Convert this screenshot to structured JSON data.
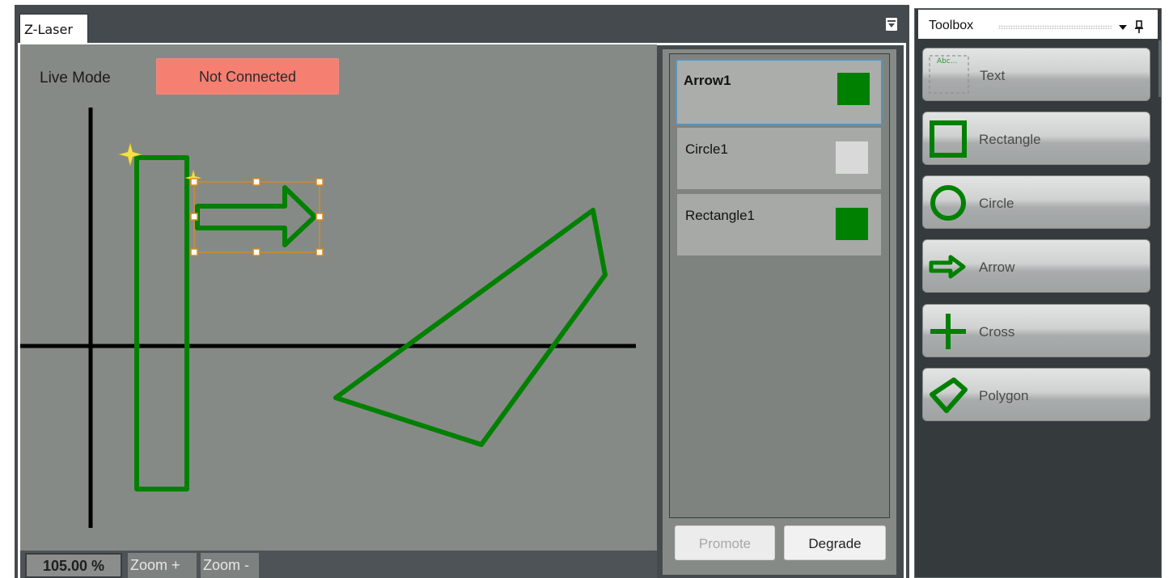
{
  "document": {
    "tab_label": "Z-Laser",
    "live_mode_label": "Live Mode",
    "connection_status": "Not Connected",
    "zoom": {
      "level": "105.00 %",
      "zoom_in_label": "Zoom +",
      "zoom_out_label": "Zoom -"
    }
  },
  "layers": {
    "items": [
      {
        "name": "Arrow1",
        "color": "#008000",
        "selected": true
      },
      {
        "name": "Circle1",
        "color": "#d9d9d9",
        "selected": false
      },
      {
        "name": "Rectangle1",
        "color": "#008000",
        "selected": false
      }
    ],
    "promote_label": "Promote",
    "degrade_label": "Degrade"
  },
  "toolbox": {
    "title": "Toolbox",
    "tools": [
      {
        "label": "Text",
        "icon": "text-tool-icon",
        "icon_text": "Abc..."
      },
      {
        "label": "Rectangle",
        "icon": "rectangle-tool-icon"
      },
      {
        "label": "Circle",
        "icon": "circle-tool-icon"
      },
      {
        "label": "Arrow",
        "icon": "arrow-tool-icon"
      },
      {
        "label": "Cross",
        "icon": "cross-tool-icon"
      },
      {
        "label": "Polygon",
        "icon": "polygon-tool-icon"
      }
    ]
  },
  "colors": {
    "shape_stroke": "#008000",
    "status_error": "#f57f71",
    "selection_outline": "#5b93b8",
    "selection_handles": "#d88a1c"
  }
}
